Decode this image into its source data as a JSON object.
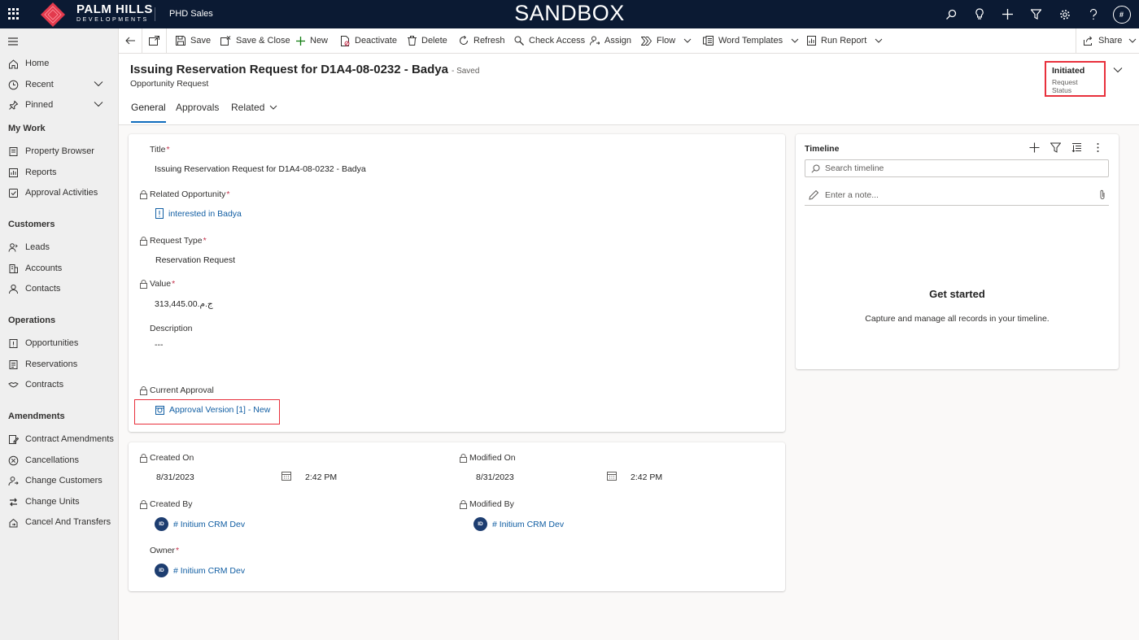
{
  "topbar": {
    "brand_main": "PALM HILLS",
    "brand_sub": "DEVELOPMENTS",
    "app_name": "PHD Sales",
    "environment": "SANDBOX",
    "user_initials": "#",
    "colors": {
      "background": "#0b1a33",
      "logo": "#e33a4d"
    }
  },
  "sidebar": {
    "home": "Home",
    "recent": "Recent",
    "pinned": "Pinned",
    "my_work": {
      "header": "My Work",
      "items": [
        "Property Browser",
        "Reports",
        "Approval Activities"
      ]
    },
    "customers": {
      "header": "Customers",
      "items": [
        "Leads",
        "Accounts",
        "Contacts"
      ]
    },
    "operations": {
      "header": "Operations",
      "items": [
        "Opportunities",
        "Reservations",
        "Contracts"
      ]
    },
    "amendments": {
      "header": "Amendments",
      "items": [
        "Contract Amendments",
        "Cancellations",
        "Change Customers",
        "Change Units",
        "Cancel And Transfers"
      ]
    }
  },
  "commands": {
    "save": "Save",
    "save_close": "Save & Close",
    "new": "New",
    "deactivate": "Deactivate",
    "delete": "Delete",
    "refresh": "Refresh",
    "check_access": "Check Access",
    "assign": "Assign",
    "flow": "Flow",
    "word_templates": "Word Templates",
    "run_report": "Run Report",
    "share": "Share"
  },
  "record": {
    "title": "Issuing Reservation Request for D1A4-08-0232 - Badya",
    "saved_status": "- Saved",
    "entity": "Opportunity Request",
    "status_value": "Initiated",
    "status_label": "Request Status",
    "tabs": [
      "General",
      "Approvals",
      "Related"
    ]
  },
  "general": {
    "title_label": "Title",
    "title_value": "Issuing Reservation Request for D1A4-08-0232 - Badya",
    "opportunity_label": "Related Opportunity",
    "opportunity_value": "interested in Badya",
    "request_type_label": "Request Type",
    "request_type_value": "Reservation Request",
    "value_label": "Value",
    "value_value": "ج.م.313,445.00",
    "description_label": "Description",
    "description_value": "---",
    "approval_label": "Current Approval",
    "approval_value": "Approval Version [1] - New"
  },
  "audit": {
    "created_on_label": "Created On",
    "created_on_date": "8/31/2023",
    "created_on_time": "2:42 PM",
    "modified_on_label": "Modified On",
    "modified_on_date": "8/31/2023",
    "modified_on_time": "2:42 PM",
    "created_by_label": "Created By",
    "created_by_value": "# Initium CRM Dev",
    "modified_by_label": "Modified By",
    "modified_by_value": "# Initium CRM Dev",
    "owner_label": "Owner",
    "owner_value": "# Initium CRM Dev",
    "user_initials": "ID"
  },
  "timeline": {
    "title": "Timeline",
    "search_placeholder": "Search timeline",
    "note_placeholder": "Enter a note...",
    "empty_title": "Get started",
    "empty_text": "Capture and manage all records in your timeline."
  },
  "required_marker": "*"
}
